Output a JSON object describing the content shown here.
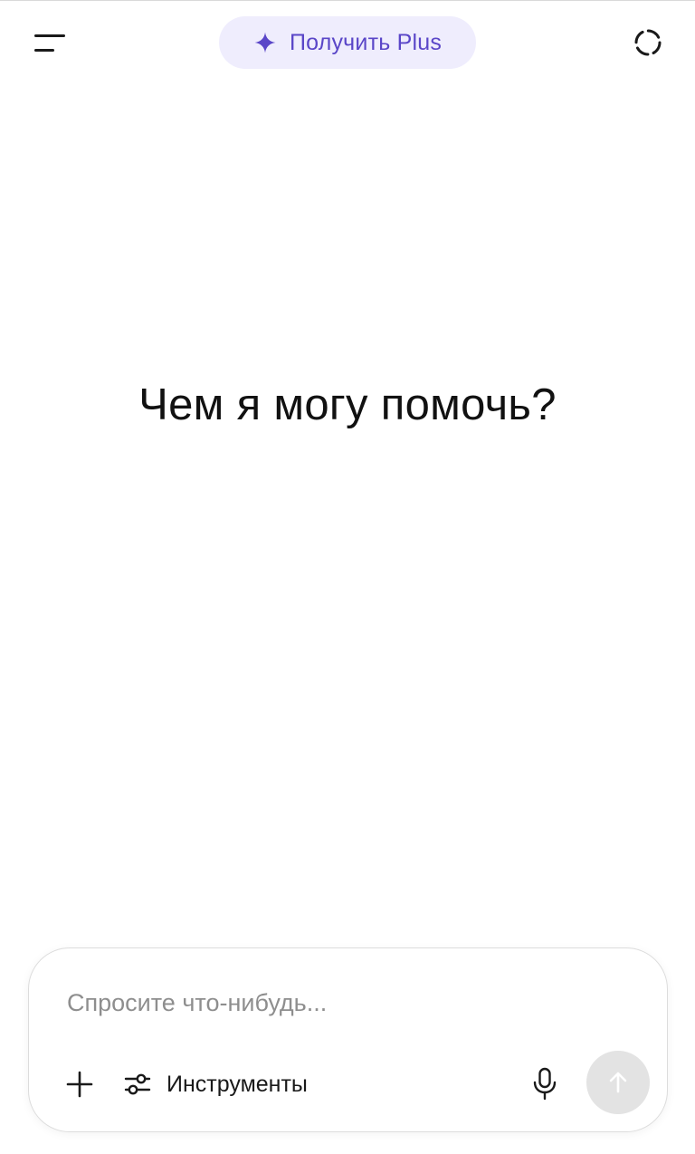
{
  "header": {
    "menu_icon": "menu-icon",
    "upgrade_label": "Получить Plus",
    "upgrade_icon": "sparkle-icon",
    "temporary_chat_icon": "dashed-circle-icon",
    "accent_color": "#5a46c8",
    "pill_color": "#efedfd"
  },
  "main": {
    "headline": "Чем я могу помочь?"
  },
  "composer": {
    "placeholder": "Спросите что-нибудь...",
    "value": "",
    "add_icon": "plus-icon",
    "tools_label": "Инструменты",
    "tools_icon": "sliders-icon",
    "mic_icon": "microphone-icon",
    "send_icon": "arrow-up-icon",
    "send_disabled_color": "#e3e3e3"
  }
}
